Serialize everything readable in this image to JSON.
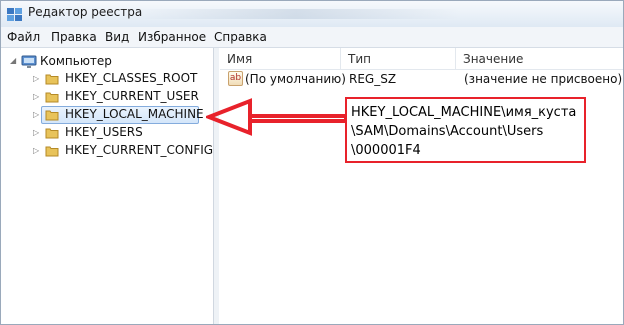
{
  "window": {
    "title": "Редактор реестра"
  },
  "menu": {
    "items": [
      "Файл",
      "Правка",
      "Вид",
      "Избранное",
      "Справка"
    ]
  },
  "tree": {
    "root_label": "Компьютер",
    "nodes": [
      "HKEY_CLASSES_ROOT",
      "HKEY_CURRENT_USER",
      "HKEY_LOCAL_MACHINE",
      "HKEY_USERS",
      "HKEY_CURRENT_CONFIG"
    ],
    "selected": "HKEY_LOCAL_MACHINE"
  },
  "values_list": {
    "columns": [
      "Имя",
      "Тип",
      "Значение"
    ],
    "rows": [
      {
        "icon": "string-value-icon",
        "icon_text": "ab",
        "name": "(По умолчанию)",
        "type": "REG_SZ",
        "value": "(значение не присвоено)"
      }
    ]
  },
  "annotation": {
    "text": "HKEY_LOCAL_MACHINE\\имя_куста\n\\SAM\\Domains\\Account\\Users\n\\000001F4",
    "border_color": "#e8222b",
    "arrow_color": "#e8222b"
  },
  "colors": {
    "selection_border": "#84acdd",
    "folder": "#e8c35a"
  }
}
